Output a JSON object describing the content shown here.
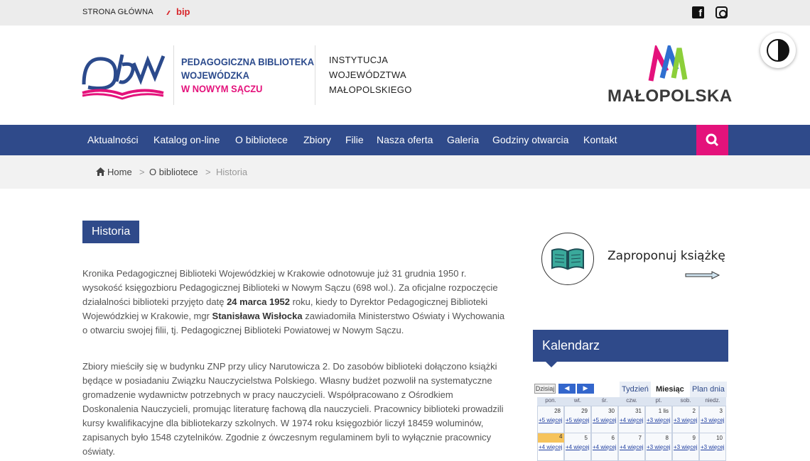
{
  "topbar": {
    "home": "STRONA GŁÓWNA",
    "bip": "bip"
  },
  "header": {
    "lib_line1": "PEDAGOGICZNA BIBLIOTEKA",
    "lib_line2": "WOJEWÓDZKA",
    "lib_line3": "W NOWYM SĄCZU",
    "inst_line1": "INSTYTUCJA",
    "inst_line2": "WOJEWÓDZTWA",
    "inst_line3": "MAŁOPOLSKIEGO",
    "malopolska": "MAŁOPOLSKA"
  },
  "nav": [
    "Aktualności",
    "Katalog on-line",
    "O bibliotece",
    "Zbiory",
    "Filie",
    "Nasza oferta",
    "Galeria",
    "Godziny otwarcia",
    "Kontakt"
  ],
  "breadcrumb": {
    "home": "Home",
    "sep": ">",
    "parent": "O bibliotece",
    "current": "Historia"
  },
  "article": {
    "title": "Historia",
    "p1_a": "Kronika Pedagogicznej Biblioteki Wojewódzkiej w Krakowie odnotowuje już 31 grudnia 1950 r. wysokość księgozbioru Pedagogicznej Biblioteki w Nowym Sączu (698 wol.). Za oficjalne rozpoczęcie działalności   biblioteki przyjęto datę ",
    "p1_date": "24 marca 1952",
    "p1_b": " roku, kiedy to Dyrektor Pedagogicznej Biblioteki Wojewódzkiej w Krakowie, mgr ",
    "p1_name": "Stanisława Wisłocka",
    "p1_c": " zawiadomiła Ministerstwo Oświaty  i Wychowania o otwarciu swojej filii,  tj. Pedagogicznej Biblioteki Powiatowej w Nowym Sączu.",
    "p2": "Zbiory mieściły się w  budynku ZNP przy ulicy Narutowicza 2. Do zasobów biblioteki dołączono książki będące  w posiadaniu Związku Nauczycielstwa Polskiego. Własny budżet  pozwolił na systematyczne gromadzenie  wydawnictw  potrzebnych w pracy nauczycieli. Współpracowano z Ośrodkiem Doskonalenia Nauczycieli, promując literaturę fachową dla nauczycieli. Pracownicy biblioteki prowadzili kursy kwalifikacyjne dla bibliotekarzy szkolnych.   W 1974 roku księgozbiór liczył 18459 woluminów, zapisanych było 1548 czytelników. Zgodnie z ówczesnym regulaminem byli to wyłącznie pracownicy oświaty."
  },
  "sidebar": {
    "suggest": "Zaproponuj książkę",
    "calendar_title": "Kalendarz",
    "today_btn": "Dzisiaj",
    "views": [
      "Tydzień",
      "Miesiąc",
      "Plan dnia"
    ],
    "weekdays": [
      "pon.",
      "wt.",
      "śr.",
      "czw.",
      "pt.",
      "sob.",
      "niedz."
    ],
    "week1": [
      {
        "d": "28",
        "m": "+5 więcej"
      },
      {
        "d": "29",
        "m": "+5 więcej"
      },
      {
        "d": "30",
        "m": "+5 więcej"
      },
      {
        "d": "31",
        "m": "+4 więcej"
      },
      {
        "d": "1 lis",
        "m": "+3 więcej"
      },
      {
        "d": "2",
        "m": "+3 więcej"
      },
      {
        "d": "3",
        "m": "+3 więcej"
      }
    ],
    "week2": [
      {
        "d": "4",
        "m": "+4 więcej"
      },
      {
        "d": "5",
        "m": "+4 więcej"
      },
      {
        "d": "6",
        "m": "+4 więcej"
      },
      {
        "d": "7",
        "m": "+4 więcej"
      },
      {
        "d": "8",
        "m": "+3 więcej"
      },
      {
        "d": "9",
        "m": "+3 więcej"
      },
      {
        "d": "10",
        "m": "+3 więcej"
      }
    ]
  },
  "colors": {
    "brand_blue": "#2f4a8a",
    "brand_pink": "#e4127b"
  }
}
